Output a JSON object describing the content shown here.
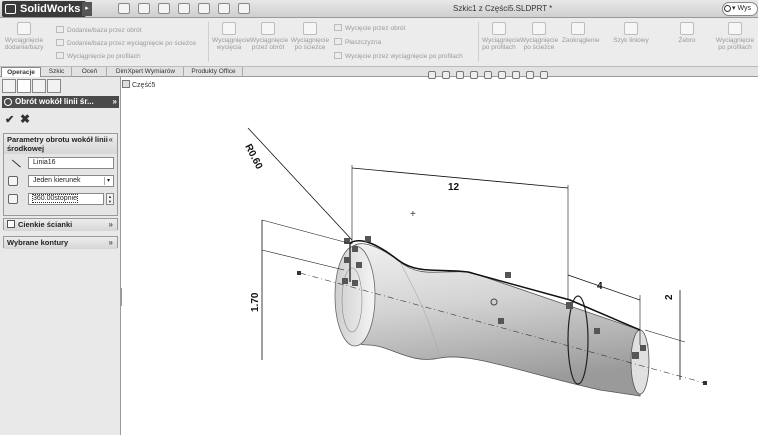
{
  "titlebar": {
    "app_name": "SolidWorks",
    "app_menu_arrow": "▸",
    "document_title": "Szkic1 z Części5.SLDPRT *",
    "search_text": "▾ Wys"
  },
  "ribbon": {
    "buttons": [
      {
        "label": "Wyciągnięcie dodania/bazy",
        "icon": "extrude-boss-icon"
      },
      {
        "label": "Wyciągnięcie wycięcia",
        "icon": "extrude-cut-icon"
      },
      {
        "label": "Wyciągnięcie przez obrót",
        "icon": "revolve-cut-icon"
      },
      {
        "label": "Wyciągnięcie po ścieżce",
        "icon": "sweep-icon"
      },
      {
        "label": "Wyciągnięcie po profilach",
        "icon": "loft-icon"
      },
      {
        "label": "Wyciągnięcie po ścieżce",
        "icon": "sweep-cut-icon"
      },
      {
        "label": "Zaokrąglenie",
        "icon": "fillet-icon"
      },
      {
        "label": "Szyk liniowy",
        "icon": "linear-pattern-icon"
      },
      {
        "label": "Żebro",
        "icon": "rib-icon"
      },
      {
        "label": "Wyciągnięcie po profilach",
        "icon": "loft-cut-icon"
      }
    ],
    "lines": [
      {
        "label": "Dodanie/baza przez obrót",
        "icon": "revolve-boss-icon"
      },
      {
        "label": "Dodanie/baza przez wyciągnięcie po ścieżce",
        "icon": "swept-boss-icon"
      },
      {
        "label": "Wyciągnięcie po profilach",
        "icon": "lofted-boss-icon"
      },
      {
        "label": "Wycięcie przez obrót",
        "icon": "revolved-cut-icon"
      },
      {
        "label": "Płaszczyzna",
        "icon": "plane-icon"
      },
      {
        "label": "Wycięcie przez wyciągnięcie po profilach",
        "icon": "lofted-cut-icon"
      }
    ]
  },
  "tabs": [
    {
      "label": "Operacje",
      "active": true
    },
    {
      "label": "Szkic",
      "active": false
    },
    {
      "label": "Oceń",
      "active": false
    },
    {
      "label": "DimXpert Wymiarów",
      "active": false
    },
    {
      "label": "Produkty Office",
      "active": false
    }
  ],
  "property_manager": {
    "header_title": "Obrót wokół linii śr...",
    "header_chevron": "»",
    "ok_glyph": "✔",
    "cancel_glyph": "✖",
    "axis_group": {
      "title": "Parametry obrotu wokół linii środkowej",
      "chevron": "«",
      "axis_value": "Linia16",
      "direction_value": "Jeden kierunek",
      "angle_value": "360.00stopnie"
    },
    "thin_group": {
      "title": "Cienkie ścianki",
      "chevron": "»"
    },
    "contours_group": {
      "title": "Wybrane kontury",
      "chevron": "»"
    }
  },
  "tree": {
    "root_label": "Część5"
  },
  "dimensions": {
    "radius": "R0.60",
    "length": "12",
    "height_left": "1.70",
    "length_right": "4",
    "height_right": "2",
    "plus_marker": "+"
  },
  "colors": {
    "model_light": "#eeeeee",
    "model_mid": "#c8c8c8",
    "model_dark": "#8a8a8a",
    "panel_header": "#4a4a4a"
  }
}
